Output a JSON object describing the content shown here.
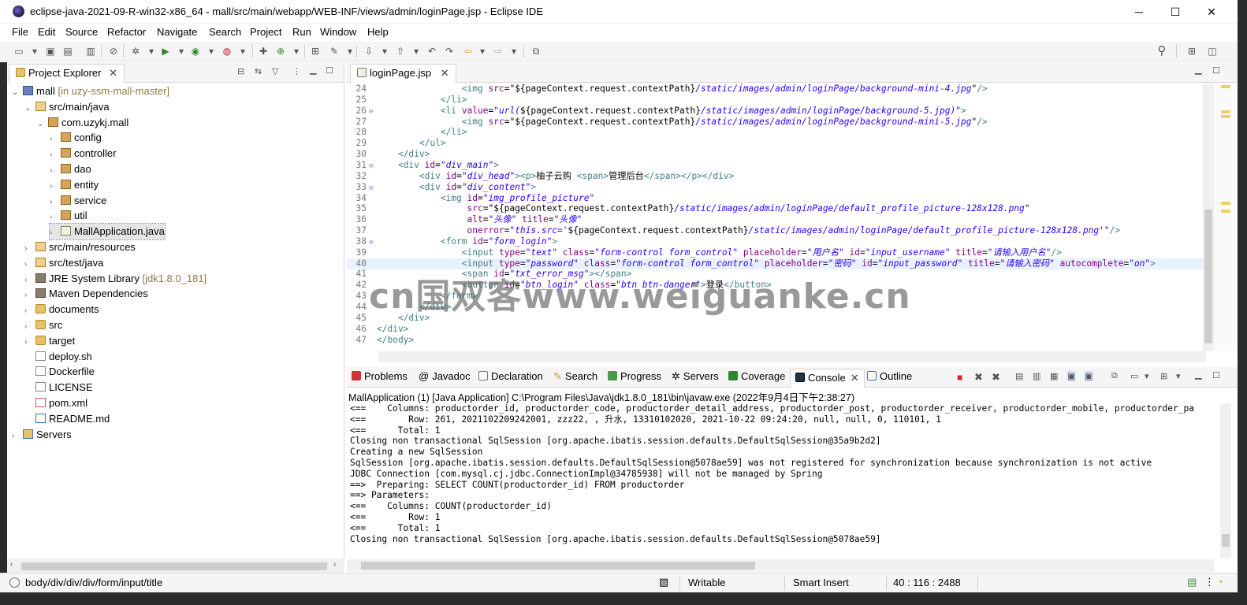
{
  "window": {
    "title": "eclipse-java-2021-09-R-win32-x86_64 - mall/src/main/webapp/WEB-INF/views/admin/loginPage.jsp - Eclipse IDE",
    "minimize": "─",
    "maximize": "☐",
    "close": "✕"
  },
  "menu": [
    "File",
    "Edit",
    "Source",
    "Refactor",
    "Navigate",
    "Search",
    "Project",
    "Run",
    "Window",
    "Help"
  ],
  "explorer": {
    "tab_label": "Project Explorer",
    "tree": [
      {
        "label": "mall",
        "decoration": " [in uzy-ssm-mall-master]",
        "indent": 0,
        "twisty": "⌄",
        "icon": "project"
      },
      {
        "label": "src/main/java",
        "decoration": "",
        "indent": 1,
        "twisty": "⌄",
        "icon": "src"
      },
      {
        "label": "com.uzykj.mall",
        "decoration": "",
        "indent": 2,
        "twisty": "⌄",
        "icon": "pkg"
      },
      {
        "label": "config",
        "decoration": "",
        "indent": 3,
        "twisty": "›",
        "icon": "pkg"
      },
      {
        "label": "controller",
        "decoration": "",
        "indent": 3,
        "twisty": "›",
        "icon": "pkg"
      },
      {
        "label": "dao",
        "decoration": "",
        "indent": 3,
        "twisty": "›",
        "icon": "pkg"
      },
      {
        "label": "entity",
        "decoration": "",
        "indent": 3,
        "twisty": "›",
        "icon": "pkg"
      },
      {
        "label": "service",
        "decoration": "",
        "indent": 3,
        "twisty": "›",
        "icon": "pkg"
      },
      {
        "label": "util",
        "decoration": "",
        "indent": 3,
        "twisty": "›",
        "icon": "pkg"
      },
      {
        "label": "MallApplication.java",
        "decoration": "",
        "indent": 3,
        "twisty": "›",
        "icon": "java",
        "selected": true
      },
      {
        "label": "src/main/resources",
        "decoration": "",
        "indent": 1,
        "twisty": "›",
        "icon": "src"
      },
      {
        "label": "src/test/java",
        "decoration": "",
        "indent": 1,
        "twisty": "›",
        "icon": "src"
      },
      {
        "label": "JRE System Library",
        "decoration": " [jdk1.8.0_181]",
        "indent": 1,
        "twisty": "›",
        "icon": "lib"
      },
      {
        "label": "Maven Dependencies",
        "decoration": "",
        "indent": 1,
        "twisty": "›",
        "icon": "lib"
      },
      {
        "label": "documents",
        "decoration": "",
        "indent": 1,
        "twisty": "›",
        "icon": "folder"
      },
      {
        "label": "src",
        "decoration": "",
        "indent": 1,
        "twisty": "›",
        "icon": "folder"
      },
      {
        "label": "target",
        "decoration": "",
        "indent": 1,
        "twisty": "›",
        "icon": "folder"
      },
      {
        "label": "deploy.sh",
        "decoration": "",
        "indent": 1,
        "twisty": "",
        "icon": "file"
      },
      {
        "label": "Dockerfile",
        "decoration": "",
        "indent": 1,
        "twisty": "",
        "icon": "file"
      },
      {
        "label": "LICENSE",
        "decoration": "",
        "indent": 1,
        "twisty": "",
        "icon": "file"
      },
      {
        "label": "pom.xml",
        "decoration": "",
        "indent": 1,
        "twisty": "",
        "icon": "xml"
      },
      {
        "label": "README.md",
        "decoration": "",
        "indent": 1,
        "twisty": "",
        "icon": "md"
      },
      {
        "label": "Servers",
        "decoration": "",
        "indent": 0,
        "twisty": "›",
        "icon": "srv"
      }
    ]
  },
  "editor": {
    "tab_label": "loginPage.jsp",
    "lines": [
      {
        "n": "24",
        "fold": "",
        "html": "                <span class=\"tag\">&lt;img</span> <span class=\"attr\">src</span>=<span class=\"txt\">\"${pageContext.request.contextPath}</span><span class=\"val\">/static/images/admin/loginPage/background-mini-4.jpg</span><span class=\"txt\">\"</span><span class=\"tag\">/&gt;</span>"
      },
      {
        "n": "25",
        "fold": "",
        "html": "            <span class=\"tag\">&lt;/li&gt;</span>"
      },
      {
        "n": "26",
        "fold": "⊖",
        "html": "            <span class=\"tag\">&lt;li</span> <span class=\"attr\">value</span>=<span class=\"val\">\"url(</span><span class=\"txt\">${pageContext.request.contextPath}</span><span class=\"val\">/static/images/admin/loginPage/background-5.jpg)\"</span><span class=\"tag\">&gt;</span>"
      },
      {
        "n": "27",
        "fold": "",
        "html": "                <span class=\"tag\">&lt;img</span> <span class=\"attr\">src</span>=<span class=\"txt\">\"${pageContext.request.contextPath}</span><span class=\"val\">/static/images/admin/loginPage/background-mini-5.jpg</span><span class=\"txt\">\"</span><span class=\"tag\">/&gt;</span>"
      },
      {
        "n": "28",
        "fold": "",
        "html": "            <span class=\"tag\">&lt;/li&gt;</span>"
      },
      {
        "n": "29",
        "fold": "",
        "html": "        <span class=\"tag\">&lt;/ul&gt;</span>"
      },
      {
        "n": "30",
        "fold": "",
        "html": "    <span class=\"tag\">&lt;/div&gt;</span>"
      },
      {
        "n": "31",
        "fold": "⊖",
        "html": "    <span class=\"tag\">&lt;div</span> <span class=\"attr\">id</span>=<span class=\"val\">\"div_main\"</span><span class=\"tag\">&gt;</span>"
      },
      {
        "n": "32",
        "fold": "",
        "html": "        <span class=\"tag\">&lt;div</span> <span class=\"attr\">id</span>=<span class=\"val\">\"div_head\"</span><span class=\"tag\">&gt;&lt;p&gt;</span><span class=\"txt\">柚子云购 </span><span class=\"tag\">&lt;span&gt;</span><span class=\"txt\">管理后台</span><span class=\"tag\">&lt;/span&gt;&lt;/p&gt;&lt;/div&gt;</span>"
      },
      {
        "n": "33",
        "fold": "⊖",
        "html": "        <span class=\"tag\">&lt;div</span> <span class=\"attr\">id</span>=<span class=\"val\">\"div_content\"</span><span class=\"tag\">&gt;</span>"
      },
      {
        "n": "34",
        "fold": "",
        "html": "            <span class=\"tag\">&lt;img</span> <span class=\"attr\">id</span>=<span class=\"val\">\"img_profile_picture\"</span>"
      },
      {
        "n": "35",
        "fold": "",
        "html": "                 <span class=\"attr\">src</span>=<span class=\"txt\">\"${pageContext.request.contextPath}</span><span class=\"val\">/static/images/admin/loginPage/default_profile_picture-128x128.png</span><span class=\"txt\">\"</span>"
      },
      {
        "n": "36",
        "fold": "",
        "html": "                 <span class=\"attr\">alt</span>=<span class=\"val\">\"头像\"</span> <span class=\"attr\">title</span>=<span class=\"val\">\"头像\"</span>"
      },
      {
        "n": "37",
        "fold": "",
        "html": "                 <span class=\"attr\">onerror</span>=<span class=\"val\">\"this.src='</span><span class=\"txt\">${pageContext.request.contextPath}</span><span class=\"val\">/static/images/admin/loginPage/default_profile_picture-128x128.png'\"</span><span class=\"tag\">/&gt;</span>"
      },
      {
        "n": "38",
        "fold": "⊖",
        "html": "            <span class=\"tag\">&lt;form</span> <span class=\"attr\">id</span>=<span class=\"val\">\"form_login\"</span><span class=\"tag\">&gt;</span>"
      },
      {
        "n": "39",
        "fold": "",
        "html": "                <span class=\"tag\">&lt;input</span> <span class=\"attr\">type</span>=<span class=\"val\">\"text\"</span> <span class=\"attr\">class</span>=<span class=\"val\">\"form-control form_control\"</span> <span class=\"attr\">placeholder</span>=<span class=\"val\">\"用户名\"</span> <span class=\"attr\">id</span>=<span class=\"val\">\"input_username\"</span> <span class=\"attr\">title</span>=<span class=\"val\">\"请输入用户名\"</span><span class=\"tag\">/&gt;</span>"
      },
      {
        "n": "40",
        "fold": "",
        "current": true,
        "html": "                <span class=\"tag\">&lt;input</span> <span class=\"attr\">type</span>=<span class=\"val\">\"password\"</span> <span class=\"attr\">class</span>=<span class=\"val\">\"form-control form_control\"</span> <span class=\"attr\">placeholder</span>=<span class=\"val\">\"密码\"</span> <span class=\"attr\">id</span>=<span class=\"val\">\"input_password\"</span> <span class=\"attr\">title</span>=<span class=\"val\">\"请输入密码\"</span> <span class=\"attr\">autocomplete</span>=<span class=\"val\">\"on\"</span><span class=\"tag\">&gt;</span>"
      },
      {
        "n": "41",
        "fold": "",
        "html": "                <span class=\"tag\">&lt;span</span> <span class=\"attr\">id</span>=<span class=\"val\">\"txt_error_msg\"</span><span class=\"tag\">&gt;&lt;/span&gt;</span>"
      },
      {
        "n": "42",
        "fold": "",
        "html": "                <span class=\"tag\">&lt;button</span> <span class=\"attr\">id</span>=<span class=\"val\">\"btn_login\"</span> <span class=\"attr\">class</span>=<span class=\"val\">\"btn btn-danger\"</span><span class=\"tag\">&gt;</span><span class=\"txt\">登录</span><span class=\"tag\">&lt;/button&gt;</span>"
      },
      {
        "n": "43",
        "fold": "",
        "html": "            <span class=\"tag\">&lt;/form&gt;</span>"
      },
      {
        "n": "44",
        "fold": "",
        "html": "        <span class=\"tag\">&lt;/div&gt;</span>"
      },
      {
        "n": "45",
        "fold": "",
        "html": "    <span class=\"tag\">&lt;/div&gt;</span>"
      },
      {
        "n": "46",
        "fold": "",
        "html": "<span class=\"tag\">&lt;/div&gt;</span>"
      },
      {
        "n": "47",
        "fold": "",
        "html": "<span class=\"tag\">&lt;/body&gt;</span>"
      }
    ]
  },
  "bottom_tabs": [
    "Problems",
    "Javadoc",
    "Declaration",
    "Search",
    "Progress",
    "Servers",
    "Coverage",
    "Console",
    "Outline"
  ],
  "console": {
    "description": "MallApplication (1) [Java Application] C:\\Program Files\\Java\\jdk1.8.0_181\\bin\\javaw.exe  (2022年9月4日下午2:38:27)",
    "lines": [
      "<==    Columns: productorder_id, productorder_code, productorder_detail_address, productorder_post, productorder_receiver, productorder_mobile, productorder_pa",
      "<==        Row: 261, 2021102209242001, zzz22, , 升水, 13310102020, 2021-10-22 09:24:20, null, null, 0, 110101, 1",
      "<==      Total: 1",
      "Closing non transactional SqlSession [org.apache.ibatis.session.defaults.DefaultSqlSession@35a9b2d2]",
      "Creating a new SqlSession",
      "SqlSession [org.apache.ibatis.session.defaults.DefaultSqlSession@5078ae59] was not registered for synchronization because synchronization is not active",
      "JDBC Connection [com.mysql.cj.jdbc.ConnectionImpl@34785938] will not be managed by Spring",
      "==>  Preparing: SELECT COUNT(productorder_id) FROM productorder",
      "==> Parameters: ",
      "<==    Columns: COUNT(productorder_id)",
      "<==        Row: 1",
      "<==      Total: 1",
      "Closing non transactional SqlSession [org.apache.ibatis.session.defaults.DefaultSqlSession@5078ae59]"
    ]
  },
  "status": {
    "path": "body/div/div/div/form/input/title",
    "writable": "Writable",
    "insert_mode": "Smart Insert",
    "position": "40 : 116 : 2488"
  },
  "watermark": "cn国双客www.weiguanke.cn",
  "colors": {
    "tag": "#3f7f7f",
    "attribute": "#7f007f",
    "value": "#2a00ff"
  }
}
